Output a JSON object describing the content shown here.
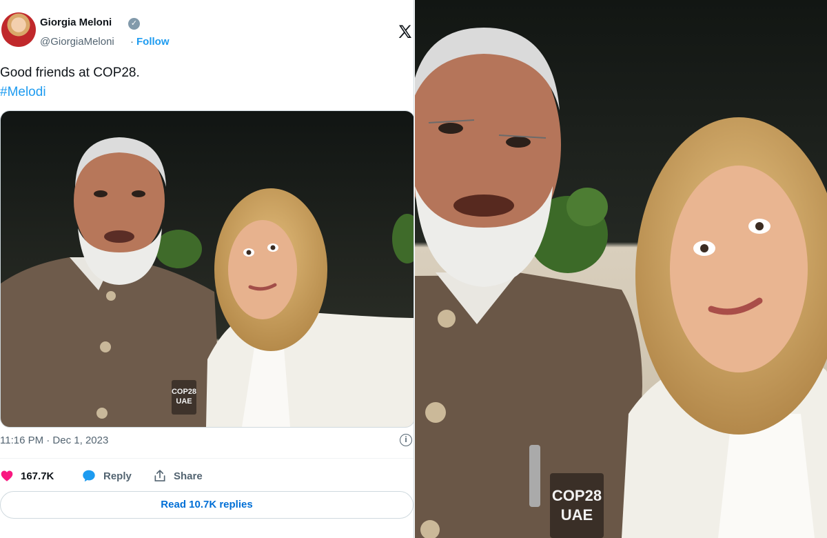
{
  "tweet": {
    "author_name": "Giorgia Meloni",
    "handle": "@GiorgiaMeloni",
    "separator": "·",
    "follow_label": "Follow",
    "text_line": "Good friends at COP28.",
    "hashtag": "#Melodi",
    "timestamp": "11:16 PM · Dec 1, 2023",
    "likes": "167.7K",
    "reply_label": "Reply",
    "share_label": "Share",
    "read_replies": "Read 10.7K replies",
    "info_glyph": "i",
    "verified_glyph": "✓"
  },
  "photo": {
    "badge_line1": "COP28",
    "badge_line2": "UAE"
  },
  "colors": {
    "accent": "#1d9bf0",
    "like": "#f91880",
    "text": "#0f1419",
    "muted": "#536471"
  },
  "icons": [
    "x-logo-icon",
    "verified-badge-icon",
    "heart-icon",
    "reply-bubble-icon",
    "share-icon",
    "info-icon"
  ]
}
